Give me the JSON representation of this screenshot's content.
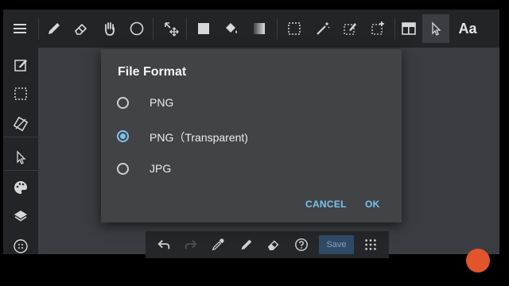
{
  "corner_watermark": "",
  "toolbar": {
    "items": [
      {
        "icon": "menu-icon"
      },
      {
        "icon": "pencil-icon"
      },
      {
        "icon": "eraser-icon"
      },
      {
        "icon": "hand-icon"
      },
      {
        "icon": "circle-icon"
      },
      {
        "icon": "move-icon"
      },
      {
        "icon": "rectangle-fill-icon"
      },
      {
        "icon": "paint-bucket-icon"
      },
      {
        "icon": "gradient-icon"
      },
      {
        "icon": "select-rect-icon"
      },
      {
        "icon": "magic-wand-icon"
      },
      {
        "icon": "select-pen-icon"
      },
      {
        "icon": "select-add-icon"
      },
      {
        "icon": "layout-icon"
      },
      {
        "icon": "pointer-icon"
      },
      {
        "icon": "text-icon"
      }
    ],
    "text_tool_label": "Aa"
  },
  "sidebar": {
    "items": [
      {
        "icon": "edit-icon"
      },
      {
        "icon": "selection-icon"
      },
      {
        "icon": "transform-icon"
      },
      {
        "icon": "cursor-icon"
      },
      {
        "icon": "palette-icon"
      },
      {
        "icon": "layers-icon"
      },
      {
        "icon": "grid-circle-icon"
      }
    ]
  },
  "bottom_bar": {
    "save_label": "Save"
  },
  "dialog": {
    "title": "File Format",
    "options": [
      {
        "label": "PNG",
        "selected": false
      },
      {
        "label": "PNG（Transparent)",
        "selected": true
      },
      {
        "label": "JPG",
        "selected": false
      }
    ],
    "cancel_label": "CANCEL",
    "ok_label": "OK"
  },
  "colors": {
    "accent": "#7cc4ef",
    "dialog_bg": "#424346",
    "toolbar_bg": "#232427"
  }
}
